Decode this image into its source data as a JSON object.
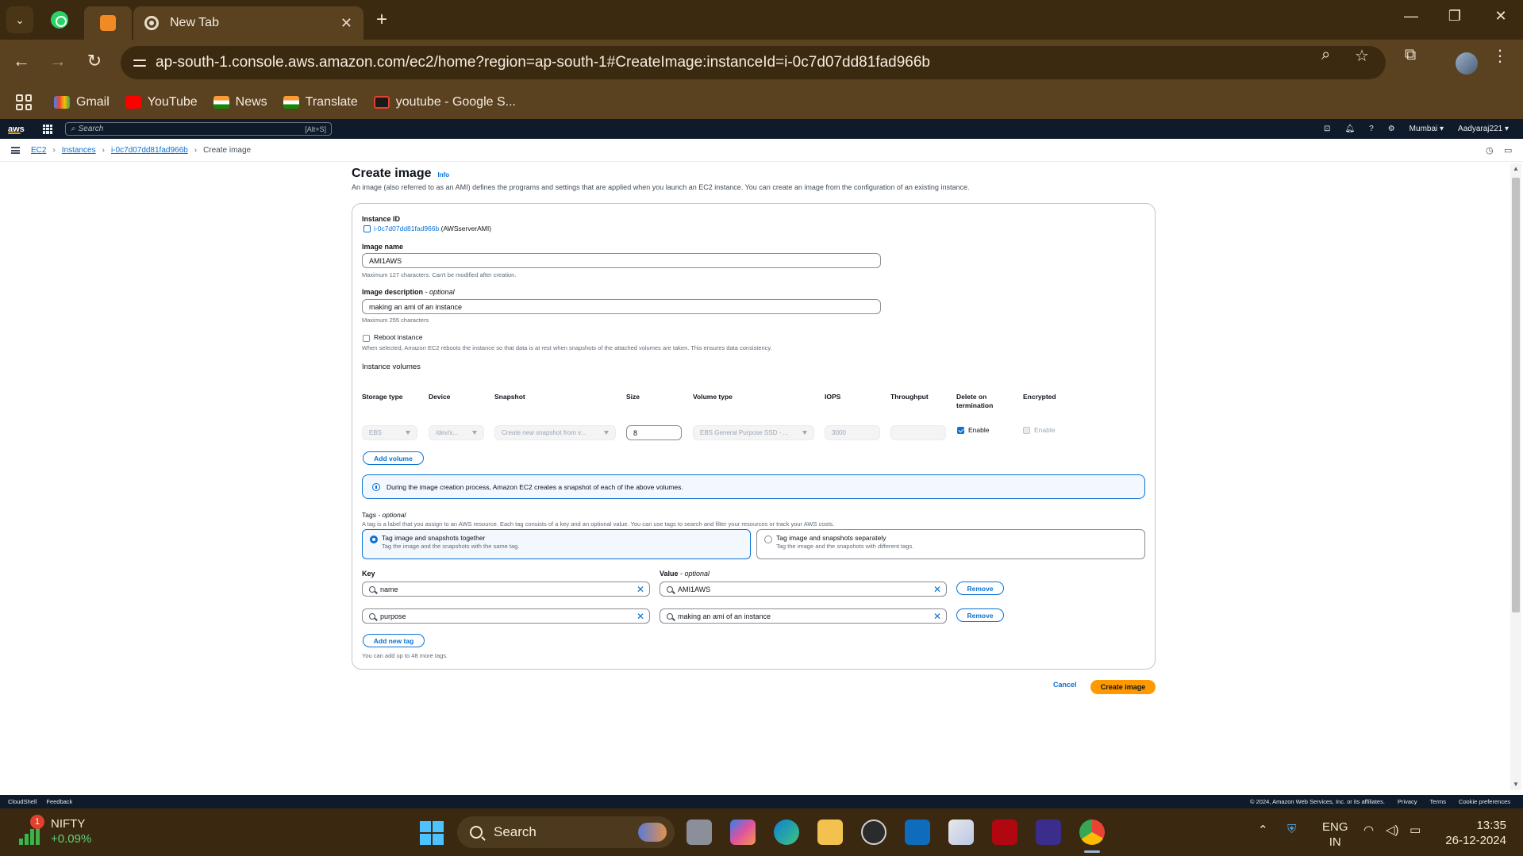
{
  "browser": {
    "tabs": [
      {
        "label": "",
        "icon": "whatsapp-icon"
      },
      {
        "label": "",
        "icon": "app-icon"
      },
      {
        "label": "New Tab",
        "icon": "chrome-icon"
      }
    ],
    "url": "ap-south-1.console.aws.amazon.com/ec2/home?region=ap-south-1#CreateImage:instanceId=i-0c7d07dd81fad966b",
    "bookmarks": [
      "Gmail",
      "YouTube",
      "News",
      "Translate",
      "youtube - Google S..."
    ]
  },
  "aws_header": {
    "logo": "aws",
    "search_placeholder": "Search",
    "search_shortcut": "[Alt+S]",
    "region": "Mumbai ▾",
    "account": "Aadyaraj221 ▾"
  },
  "breadcrumb": {
    "items": [
      "EC2",
      "Instances",
      "i-0c7d07dd81fad966b"
    ],
    "current": "Create image"
  },
  "page": {
    "title": "Create image",
    "info": "Info",
    "description": "An image (also referred to as an AMI) defines the programs and settings that are applied when you launch an EC2 instance. You can create an image from the configuration of an existing instance."
  },
  "form": {
    "instance_id_label": "Instance ID",
    "instance_id": "i-0c7d07dd81fad966b",
    "instance_name": "(AWSserverAMI)",
    "image_name_label": "Image name",
    "image_name_value": "AMI1AWS",
    "image_name_hint": "Maximum 127 characters. Can't be modified after creation.",
    "image_desc_label": "Image description",
    "image_desc_optional": "- optional",
    "image_desc_value": "making an ami of an instance",
    "image_desc_hint": "Maximum 255 characters",
    "reboot_label": "Reboot instance",
    "reboot_hint": "When selected, Amazon EC2 reboots the instance so that data is at rest when snapshots of the attached volumes are taken. This ensures data consistency.",
    "volumes_heading": "Instance volumes"
  },
  "volumes": {
    "headers": [
      "Storage type",
      "Device",
      "Snapshot",
      "Size",
      "Volume type",
      "IOPS",
      "Throughput",
      "Delete on termination",
      "Encrypted"
    ],
    "row": {
      "storage_type": "EBS",
      "device": "/dev/x...",
      "snapshot": "Create new snapshot from v...",
      "size": "8",
      "volume_type": "EBS General Purpose SSD - ...",
      "iops": "3000",
      "throughput": "",
      "delete_on_termination": "Enable",
      "encrypted": "Enable"
    },
    "add_volume": "Add volume",
    "info_alert": "During the image creation process, Amazon EC2 creates a snapshot of each of the above volumes."
  },
  "tags": {
    "label": "Tags",
    "optional": "- optional",
    "desc": "A tag is a label that you assign to an AWS resource. Each tag consists of a key and an optional value. You can use tags to search and filter your resources or track your AWS costs.",
    "option_together": "Tag image and snapshots together",
    "option_together_desc": "Tag the image and the snapshots with the same tag.",
    "option_separately": "Tag image and snapshots separately",
    "option_separately_desc": "Tag the image and the snapshots with different tags.",
    "key_label": "Key",
    "value_label": "Value",
    "value_optional": "- optional",
    "rows": [
      {
        "key": "name",
        "value": "AMI1AWS",
        "remove": "Remove"
      },
      {
        "key": "purpose",
        "value": "making an ami of an instance",
        "remove": "Remove"
      }
    ],
    "add_new_tag": "Add new tag",
    "limit_hint": "You can add up to 48 more tags."
  },
  "actions": {
    "cancel": "Cancel",
    "create": "Create image"
  },
  "aws_footer": {
    "cloudshell": "CloudShell",
    "feedback": "Feedback",
    "copyright": "© 2024, Amazon Web Services, Inc. or its affiliates.",
    "privacy": "Privacy",
    "terms": "Terms",
    "cookies": "Cookie preferences"
  },
  "taskbar": {
    "widget_badge": "1",
    "widget_name": "NIFTY",
    "widget_change": "+0.09%",
    "search": "Search",
    "lang1": "ENG",
    "lang2": "IN",
    "time": "13:35",
    "date": "26-12-2024"
  },
  "colors": {
    "aws_blue": "#0972d3",
    "aws_orange": "#ff9900",
    "aws_nav": "#0f1b2a",
    "chrome_theme": "#5a4120"
  }
}
